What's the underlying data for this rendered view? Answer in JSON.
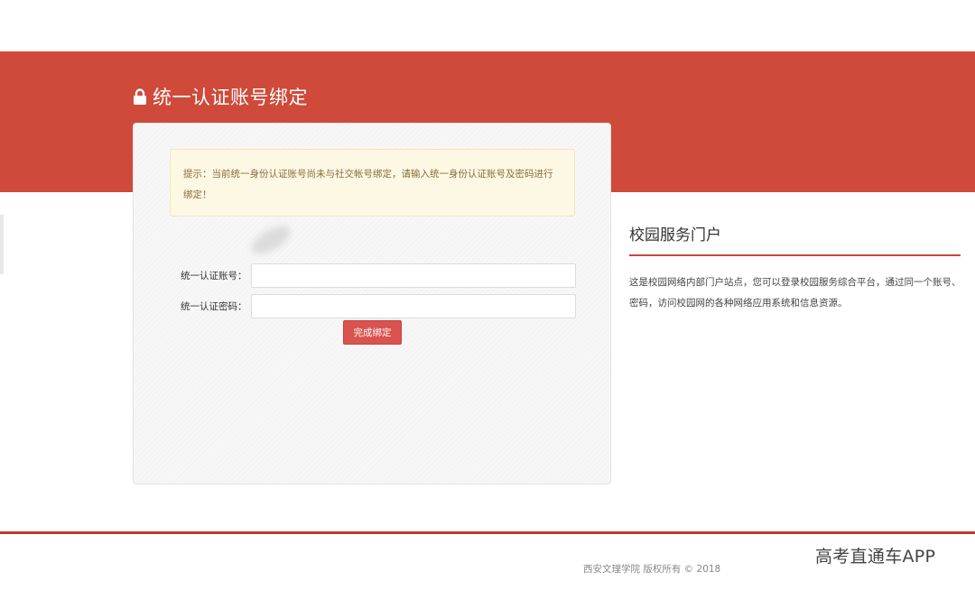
{
  "header": {
    "title": "统一认证账号绑定",
    "icon": "lock-icon"
  },
  "notice": {
    "text": "提示：当前统一身份认证账号尚未与社交帐号绑定，请输入统一身份认证账号及密码进行绑定！"
  },
  "form": {
    "account_label": "统一认证账号：",
    "account_value": "",
    "password_label": "统一认证密码：",
    "password_value": "",
    "submit_label": "完成绑定"
  },
  "portal": {
    "title": "校园服务门户",
    "description": "这是校园网络内部门户站点，您可以登录校园服务综合平台，通过同一个账号、密码，访问校园网的各种网络应用系统和信息资源。"
  },
  "footer": {
    "copyright": "西安文理学院 版权所有 © 2018"
  },
  "watermark": {
    "text": "高考直通车APP"
  },
  "colors": {
    "banner": "#cf4a3a",
    "button": "#d9534f",
    "notice_bg": "#fcf8e3",
    "notice_text": "#8a6d3b",
    "accent_rule": "#c9473a"
  }
}
